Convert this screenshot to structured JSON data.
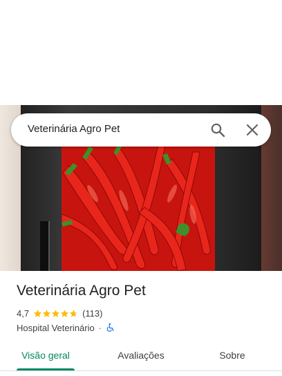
{
  "search": {
    "query": "Veterinária Agro Pet",
    "search_icon": "search-icon",
    "close_icon": "close-icon"
  },
  "place": {
    "name": "Veterinária Agro Pet",
    "rating": "4,7",
    "rating_value": 4.7,
    "review_count": "(113)",
    "category": "Hospital Veterinário",
    "separator": "·",
    "accessibility_icon": "wheelchair-icon"
  },
  "tabs": [
    {
      "label": "Visão geral",
      "active": true
    },
    {
      "label": "Avaliações",
      "active": false
    },
    {
      "label": "Sobre",
      "active": false
    }
  ],
  "colors": {
    "accent": "#01875f",
    "star": "#fbbc04",
    "accessibility": "#1a73e8"
  }
}
